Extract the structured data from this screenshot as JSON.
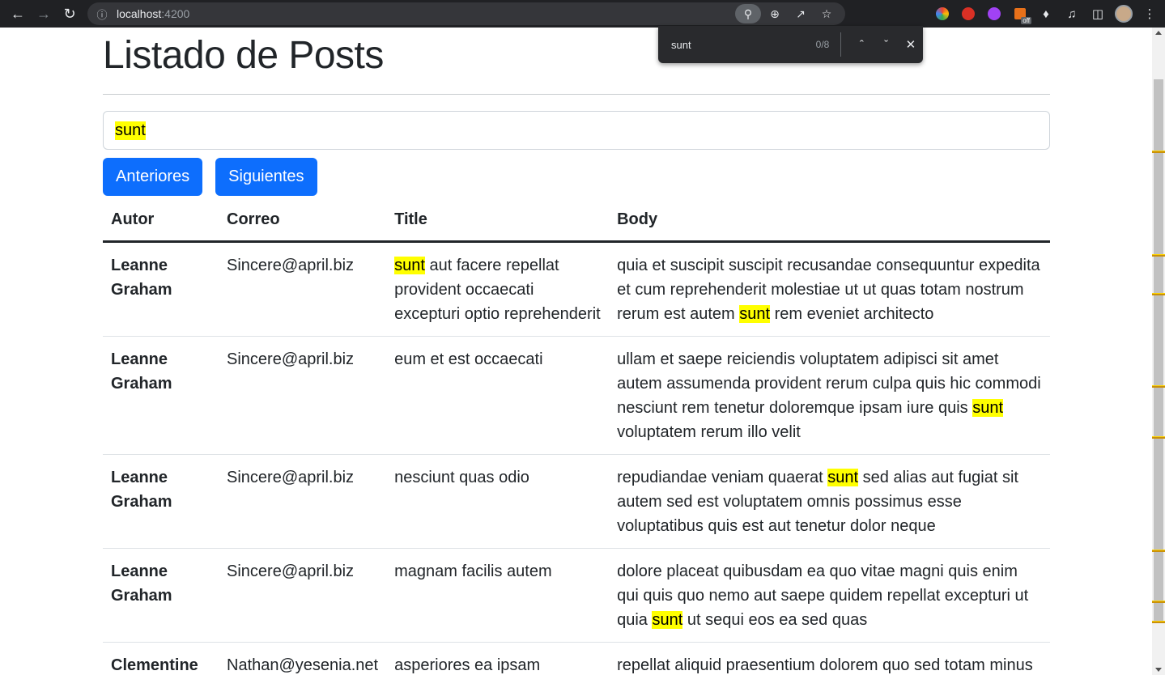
{
  "browser": {
    "url_host": "localhost",
    "url_port": ":4200",
    "find": {
      "query": "sunt",
      "count": "0/8"
    }
  },
  "page": {
    "title": "Listado de Posts",
    "search_value": "sunt",
    "buttons": {
      "prev": "Anteriores",
      "next": "Siguientes"
    },
    "table": {
      "headers": [
        "Autor",
        "Correo",
        "Title",
        "Body"
      ],
      "rows": [
        {
          "autor": "Leanne Graham",
          "correo": "Sincere@april.biz",
          "title_parts": [
            "",
            "sunt",
            " aut facere repellat provident occaecati excepturi optio reprehenderit"
          ],
          "body_parts": [
            "quia et suscipit suscipit recusandae consequuntur expedita et cum reprehenderit molestiae ut ut quas totam nostrum rerum est autem ",
            "sunt",
            " rem eveniet architecto"
          ]
        },
        {
          "autor": "Leanne Graham",
          "correo": "Sincere@april.biz",
          "title_parts": [
            "eum et est occaecati",
            "",
            ""
          ],
          "body_parts": [
            "ullam et saepe reiciendis voluptatem adipisci sit amet autem assumenda provident rerum culpa quis hic commodi nesciunt rem tenetur doloremque ipsam iure quis ",
            "sunt",
            " voluptatem rerum illo velit"
          ]
        },
        {
          "autor": "Leanne Graham",
          "correo": "Sincere@april.biz",
          "title_parts": [
            "nesciunt quas odio",
            "",
            ""
          ],
          "body_parts": [
            "repudiandae veniam quaerat ",
            "sunt",
            " sed alias aut fugiat sit autem sed est voluptatem omnis possimus esse voluptatibus quis est aut tenetur dolor neque"
          ]
        },
        {
          "autor": "Leanne Graham",
          "correo": "Sincere@april.biz",
          "title_parts": [
            "magnam facilis autem",
            "",
            ""
          ],
          "body_parts": [
            "dolore placeat quibusdam ea quo vitae magni quis enim qui quis quo nemo aut saepe quidem repellat excepturi ut quia ",
            "sunt",
            " ut sequi eos ea sed quas"
          ]
        },
        {
          "autor": "Clementine",
          "correo": "Nathan@yesenia.net",
          "title_parts": [
            "asperiores ea ipsam",
            "",
            ""
          ],
          "body_parts": [
            "repellat aliquid praesentium dolorem quo sed totam minus",
            "",
            ""
          ]
        }
      ]
    }
  },
  "colors": {
    "primary": "#0d6efd",
    "highlight": "#ffff00",
    "chrome": "#202124"
  }
}
